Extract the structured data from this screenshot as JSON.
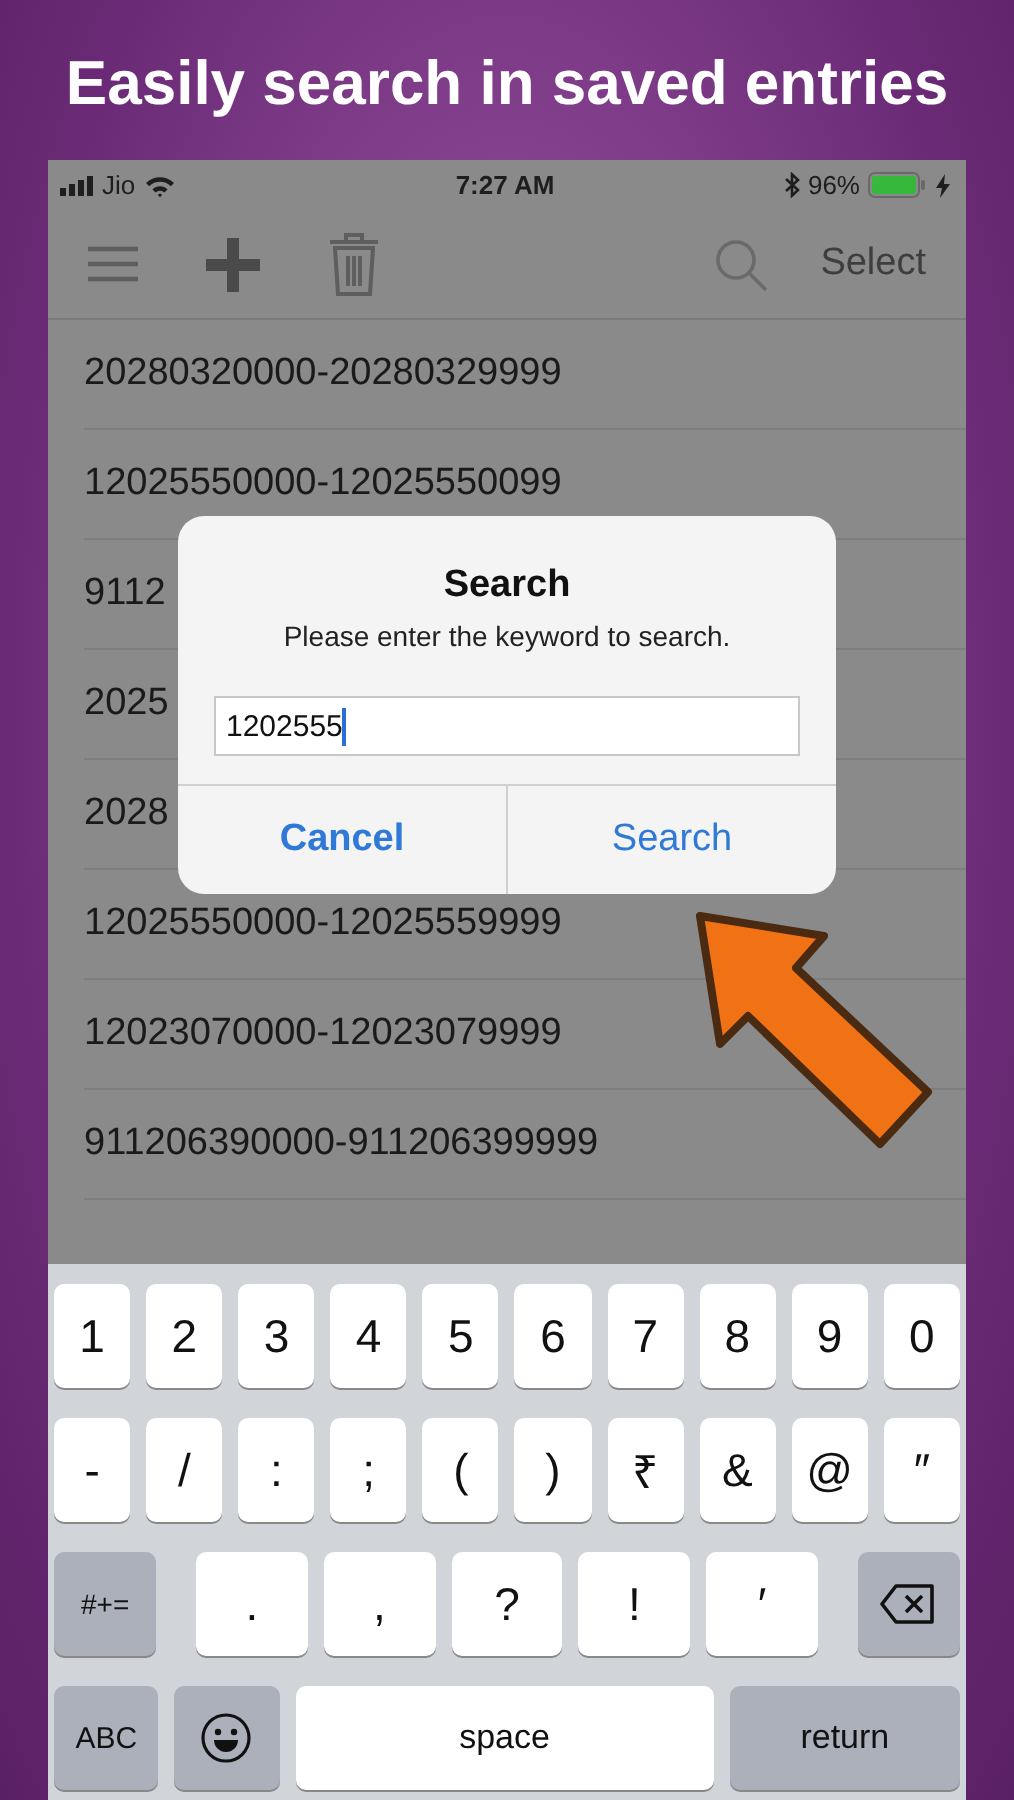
{
  "headline": "Easily search in saved entries",
  "status_bar": {
    "carrier": "Jio",
    "time": "7:27 AM",
    "battery": "96%"
  },
  "toolbar": {
    "select": "Select"
  },
  "rows": [
    {
      "text": "20280320000-20280329999"
    },
    {
      "text": "12025550000-12025550099"
    },
    {
      "text": "9112"
    },
    {
      "text": "2025"
    },
    {
      "text": "2028"
    },
    {
      "text": "12025550000-12025559999"
    },
    {
      "text": "12023070000-12023079999"
    },
    {
      "text": "911206390000-911206399999"
    }
  ],
  "dialog": {
    "title": "Search",
    "message": "Please enter the keyword to search.",
    "value": "1202555",
    "buttons": [
      {
        "label": "Cancel",
        "kind": "cancel"
      },
      {
        "label": "Search",
        "kind": "default"
      }
    ]
  },
  "keyboard": [
    [
      {
        "kind": "char",
        "label": "1"
      },
      {
        "kind": "char",
        "label": "2"
      },
      {
        "kind": "char",
        "label": "3"
      },
      {
        "kind": "char",
        "label": "4"
      },
      {
        "kind": "char",
        "label": "5"
      },
      {
        "kind": "char",
        "label": "6"
      },
      {
        "kind": "char",
        "label": "7"
      },
      {
        "kind": "char",
        "label": "8"
      },
      {
        "kind": "char",
        "label": "9"
      },
      {
        "kind": "char",
        "label": "0"
      }
    ],
    [
      {
        "kind": "char",
        "label": "-"
      },
      {
        "kind": "char",
        "label": "/"
      },
      {
        "kind": "char",
        "label": ":"
      },
      {
        "kind": "char",
        "label": ";"
      },
      {
        "kind": "char",
        "label": "("
      },
      {
        "kind": "char",
        "label": ")"
      },
      {
        "kind": "char",
        "label": "₹"
      },
      {
        "kind": "char",
        "label": "&"
      },
      {
        "kind": "char",
        "label": "@"
      },
      {
        "kind": "char",
        "label": "″"
      }
    ],
    [
      {
        "kind": "function",
        "label": "#+="
      },
      {
        "kind": "wide",
        "label": "."
      },
      {
        "kind": "wide",
        "label": ","
      },
      {
        "kind": "wide",
        "label": "?"
      },
      {
        "kind": "wide",
        "label": "!"
      },
      {
        "kind": "wide",
        "label": "′"
      },
      {
        "kind": "delete"
      }
    ],
    [
      {
        "kind": "function",
        "label": "ABC"
      },
      {
        "kind": "emoji"
      },
      {
        "kind": "space",
        "label": "space"
      },
      {
        "kind": "return",
        "label": "return"
      }
    ]
  ]
}
